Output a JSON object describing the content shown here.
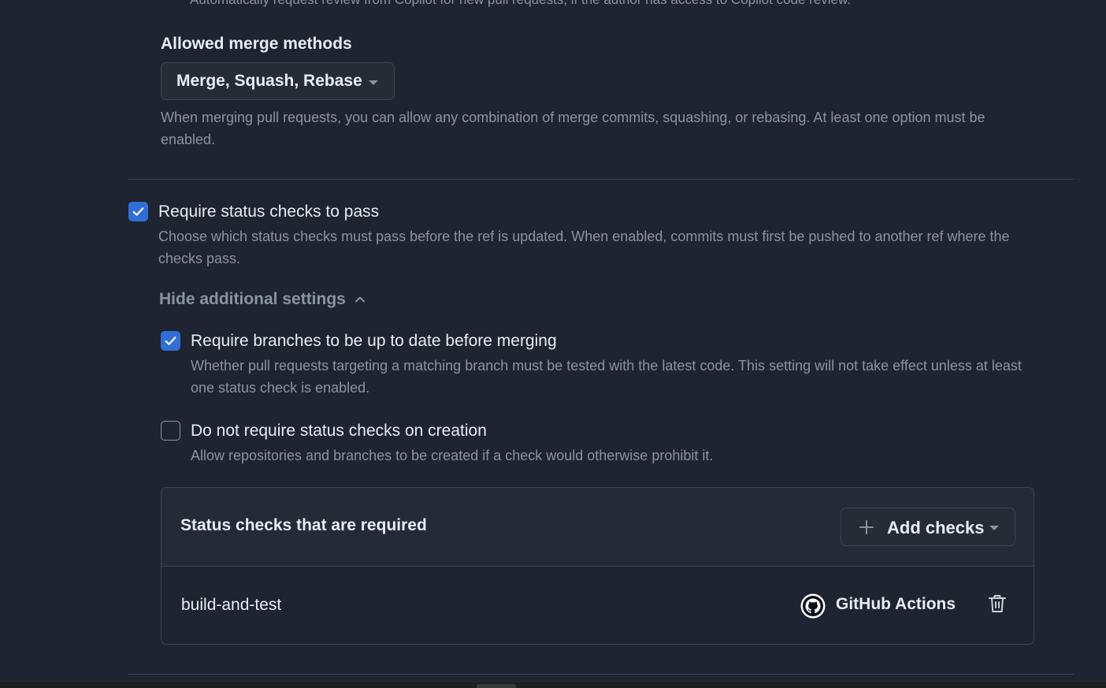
{
  "header": {
    "clipped_text": "Automatically request review from Copilot for new pull requests, if the author has access to Copilot code review."
  },
  "merge_methods": {
    "title": "Allowed merge methods",
    "selected": "Merge, Squash, Rebase",
    "description": "When merging pull requests, you can allow any combination of merge commits, squashing, or rebasing. At least one option must be enabled."
  },
  "status_checks": {
    "checkbox_checked": true,
    "label": "Require status checks to pass",
    "description": "Choose which status checks must pass before the ref is updated. When enabled, commits must first be pushed to another ref where the checks pass.",
    "toggle_label": "Hide additional settings",
    "options": [
      {
        "checked": true,
        "label": "Require branches to be up to date before merging",
        "description": "Whether pull requests targeting a matching branch must be tested with the latest code. This setting will not take effect unless at least one status check is enabled."
      },
      {
        "checked": false,
        "label": "Do not require status checks on creation",
        "description": "Allow repositories and branches to be created if a check would otherwise prohibit it."
      }
    ],
    "required_box": {
      "title": "Status checks that are required",
      "add_button_label": "Add checks",
      "checks": [
        {
          "name": "build-and-test",
          "provider": "GitHub Actions",
          "provider_icon": "github-icon"
        }
      ]
    }
  },
  "colors": {
    "background": "#1f2430",
    "accent": "#2f6fd6",
    "text": "#e6edf3",
    "muted": "#8b949e",
    "border": "#3d444d"
  }
}
